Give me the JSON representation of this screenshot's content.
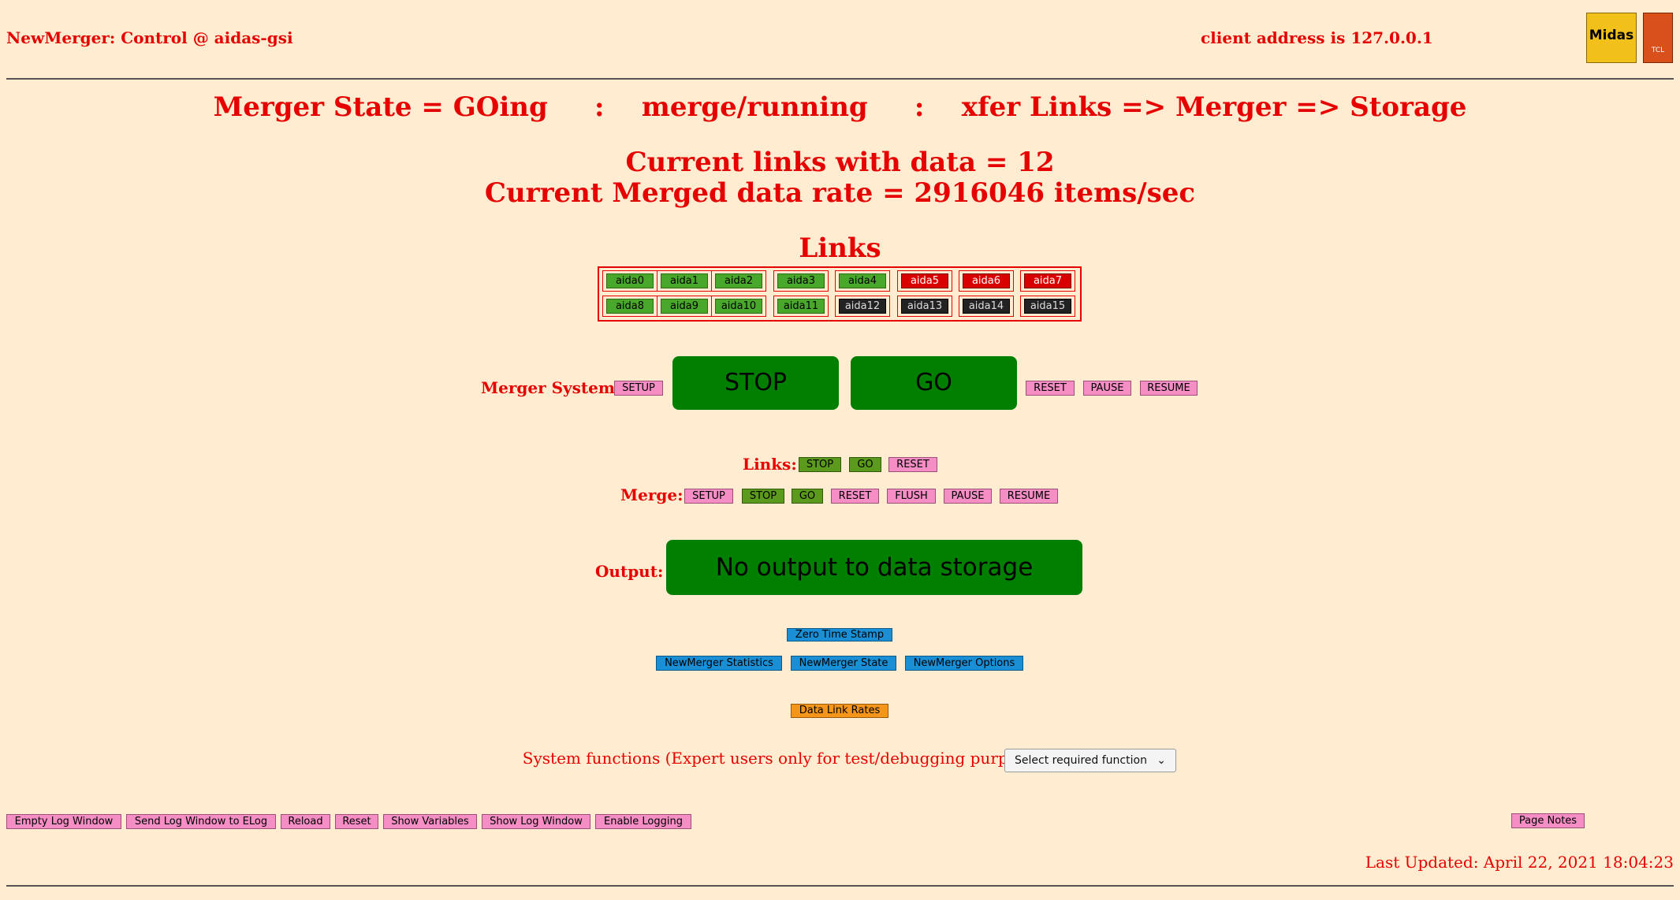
{
  "header": {
    "title": "NewMerger: Control @ aidas-gsi",
    "client": "client address is 127.0.0.1",
    "logo_midas": "Midas",
    "logo_tcl": "TCL"
  },
  "status": {
    "state_line": "Merger State = GOing     :    merge/running     :    xfer Links => Merger => Storage",
    "links_with_data": "Current links with data = 12",
    "merged_rate": "Current Merged data rate = 2916046 items/sec"
  },
  "links": {
    "title": "Links",
    "row1": [
      "aida0",
      "aida1",
      "aida2",
      "aida3",
      "aida4",
      "aida5",
      "aida6",
      "aida7"
    ],
    "row2": [
      "aida8",
      "aida9",
      "aida10",
      "aida11",
      "aida12",
      "aida13",
      "aida14",
      "aida15"
    ],
    "row1_colors": [
      "#49a82b",
      "#49a82b",
      "#49a82b",
      "#49a82b",
      "#49a82b",
      "#d90000",
      "#d90000",
      "#d90000"
    ],
    "row2_colors": [
      "#49a82b",
      "#49a82b",
      "#49a82b",
      "#49a82b",
      "#222222",
      "#222222",
      "#222222",
      "#222222"
    ]
  },
  "merger_system": {
    "label": "Merger System:",
    "setup": "SETUP",
    "stop": "STOP",
    "go": "GO",
    "reset": "RESET",
    "pause": "PAUSE",
    "resume": "RESUME"
  },
  "links_controls": {
    "label": "Links:",
    "stop": "STOP",
    "go": "GO",
    "reset": "RESET"
  },
  "merge_controls": {
    "label": "Merge:",
    "setup": "SETUP",
    "stop": "STOP",
    "go": "GO",
    "reset": "RESET",
    "flush": "FLUSH",
    "pause": "PAUSE",
    "resume": "RESUME"
  },
  "output": {
    "label": "Output:",
    "value": "No output to data storage"
  },
  "tools": {
    "zero_time_stamp": "Zero Time Stamp",
    "statistics": "NewMerger Statistics",
    "state": "NewMerger State",
    "options": "NewMerger Options",
    "data_link_rates": "Data Link Rates"
  },
  "system_functions": {
    "note": "System functions (Expert users only for test/debugging purposes!!!)",
    "selected": "Select required function"
  },
  "footer": {
    "buttons": [
      "Empty Log Window",
      "Send Log Window to ELog",
      "Reload",
      "Reset",
      "Show Variables",
      "Show Log Window",
      "Enable Logging"
    ],
    "page_notes": "Page Notes",
    "last_updated": "Last Updated: April 22, 2021 18:04:23"
  },
  "colors": {
    "background": "#ffecd1",
    "text_red": "#e60000",
    "big_button_green": "#007f00",
    "pink_button": "#f48ec4",
    "olive_button": "#5b9a1c",
    "blue_button": "#1a8fd6",
    "orange_button": "#f5961a"
  }
}
